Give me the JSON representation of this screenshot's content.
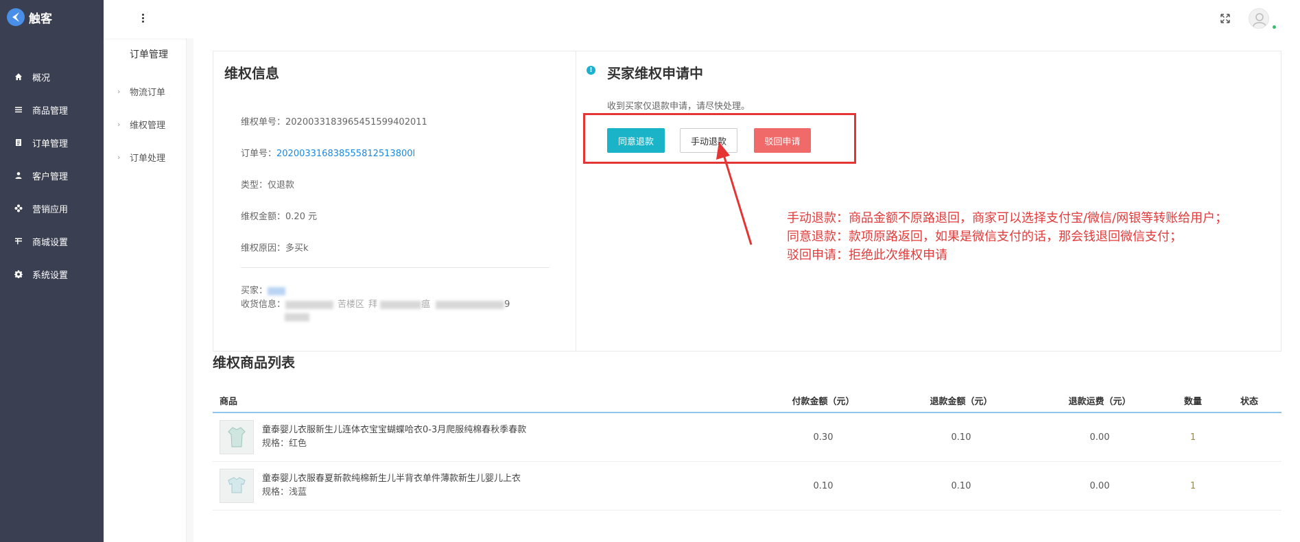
{
  "app": {
    "name": "触客"
  },
  "sidebar": {
    "items": [
      {
        "label": "概况",
        "icon": "home-icon"
      },
      {
        "label": "商品管理",
        "icon": "list-icon"
      },
      {
        "label": "订单管理",
        "icon": "order-icon"
      },
      {
        "label": "客户管理",
        "icon": "user-icon"
      },
      {
        "label": "营销应用",
        "icon": "marketing-icon"
      },
      {
        "label": "商城设置",
        "icon": "store-settings-icon"
      },
      {
        "label": "系统设置",
        "icon": "gear-icon"
      }
    ]
  },
  "subnav": {
    "title": "订单管理",
    "items": [
      {
        "label": "物流订单"
      },
      {
        "label": "维权管理"
      },
      {
        "label": "订单处理"
      }
    ]
  },
  "info": {
    "title": "维权信息",
    "rights_no_label": "维权单号：",
    "rights_no": "2020033183965451599402011",
    "order_no_label": "订单号：",
    "order_no": "202003316838555812513800l",
    "type_label": "类型：",
    "type": "仅退款",
    "amount_label": "维权金额：",
    "amount": "0.20 元",
    "reason_label": "维权原因：",
    "reason": "多买k",
    "buyer_label": "买家：",
    "address_label": "收货信息：",
    "address_visible_1": "苦楼区",
    "address_visible_2": "拜",
    "address_visible_3": "瘟",
    "address_tail": "9"
  },
  "status": {
    "title": "买家维权申请中",
    "desc": "收到买家仅退款申请，请尽快处理。",
    "btn_agree": "同意退款",
    "btn_manual": "手动退款",
    "btn_reject": "驳回申请"
  },
  "annotation": {
    "line1": "手动退款：商品金额不原路退回，商家可以选择支付宝/微信/网银等转账给用户；",
    "line2": "同意退款：款项原路返回，如果是微信支付的话，那会钱退回微信支付；",
    "line3": "驳回申请：拒绝此次维权申请"
  },
  "list": {
    "title": "维权商品列表",
    "columns": {
      "product": "商品",
      "paid": "付款金额（元）",
      "refund": "退款金额（元）",
      "shipping": "退款运费（元）",
      "qty": "数量",
      "status": "状态"
    },
    "rows": [
      {
        "name": "童泰婴儿衣服新生儿连体衣宝宝蝴蝶哈衣0-3月爬服纯棉春秋季春款",
        "spec": "规格：红色",
        "paid": "0.30",
        "refund": "0.10",
        "shipping": "0.00",
        "qty": "1",
        "status": ""
      },
      {
        "name": "童泰婴儿衣服春夏新款纯棉新生儿半背衣单件薄款新生儿婴儿上衣",
        "spec": "规格：浅蓝",
        "paid": "0.10",
        "refund": "0.10",
        "shipping": "0.00",
        "qty": "1",
        "status": ""
      }
    ]
  },
  "colors": {
    "sidebar_bg": "#3a3f51",
    "agree": "#1ab3c8",
    "reject": "#f06a6a",
    "link": "#1a8ae0",
    "annotation": "#e53434"
  }
}
